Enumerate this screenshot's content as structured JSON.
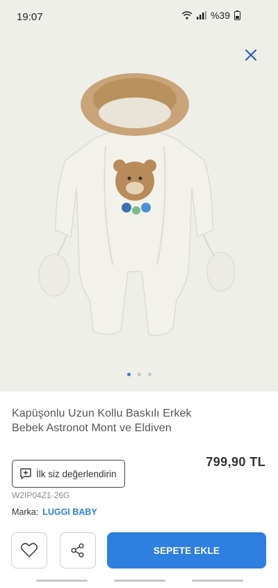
{
  "status": {
    "time": "19:07",
    "battery": "%39",
    "icons": [
      "wifi-icon",
      "signal-icon",
      "battery-icon"
    ]
  },
  "gallery": {
    "close_icon": "close-icon",
    "image": "white-baby-snowsuit-with-fur-hood-and-mittens",
    "dots": 3,
    "active_dot": 1
  },
  "product": {
    "title": "Kapüşonlu Uzun Kollu Baskılı Erkek Bebek Astronot Mont ve Eldiven",
    "review_label": "İlk siz değerlendirin",
    "price": "799,90 TL",
    "sku": "W2IP04Z1-26G",
    "brand_label": "Marka:",
    "brand": "LUGGI BABY"
  },
  "actions": {
    "favorite_icon": "heart-icon",
    "share_icon": "share-icon",
    "add_to_cart": "SEPETE EKLE"
  },
  "colors": {
    "accent": "#2f7fe0",
    "background_gallery": "#efefea"
  }
}
